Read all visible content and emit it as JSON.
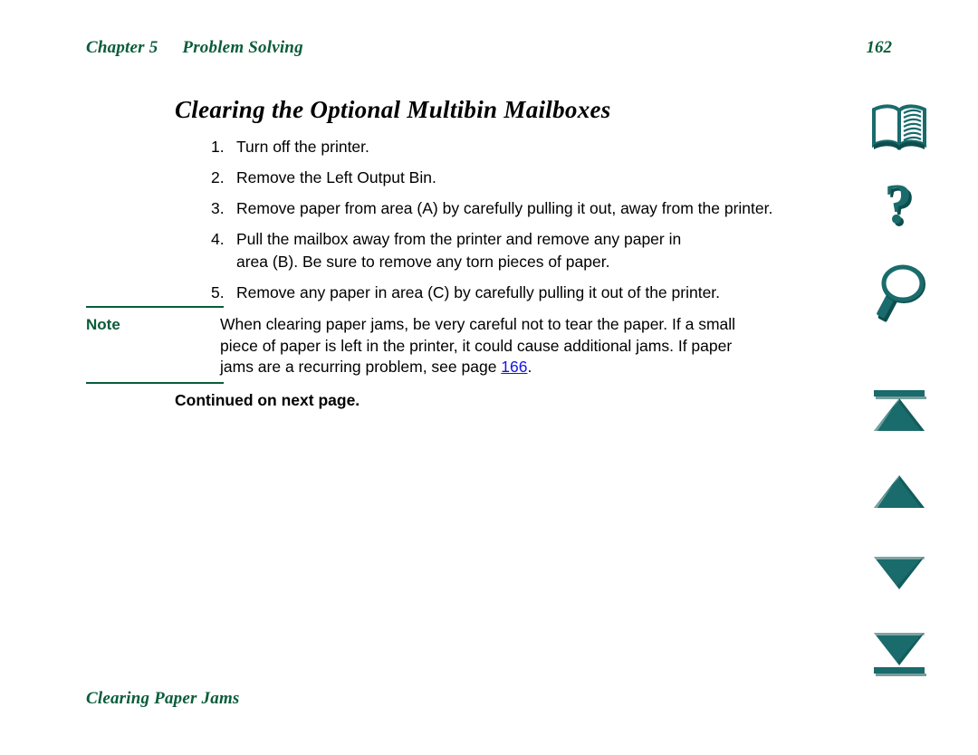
{
  "header": {
    "chapter": "Chapter 5",
    "section": "Problem Solving",
    "page_number": "162"
  },
  "title": "Clearing the Optional Multibin Mailboxes",
  "steps": [
    {
      "number": "1.",
      "line1": "Turn off the printer.",
      "line2": ""
    },
    {
      "number": "2.",
      "line1": "Remove the Left Output Bin.",
      "line2": ""
    },
    {
      "number": "3.",
      "line1": "Remove paper from area (A) by carefully pulling it out, away from the printer.",
      "line2": ""
    },
    {
      "number": "4.",
      "line1": "Pull the mailbox away from the printer and remove any paper in",
      "line2": "area (B). Be sure to remove any torn pieces of paper."
    },
    {
      "number": "5.",
      "line1": "Remove any paper in area (C) by carefully pulling it out of the printer.",
      "line2": ""
    }
  ],
  "note": {
    "label": "Note",
    "line1": "When clearing paper jams, be very careful not to tear the paper. If a small",
    "line2": "piece of paper is left in the printer, it could cause additional jams. If paper",
    "line3_prefix": "jams are a recurring problem, see page ",
    "link_text": "166",
    "line3_suffix": "."
  },
  "continued": "Continued on next page.",
  "footer": "Clearing Paper Jams",
  "icons": [
    {
      "name": "book-icon",
      "label": "Table of Contents"
    },
    {
      "name": "question-mark-icon",
      "label": "Help"
    },
    {
      "name": "magnifier-icon",
      "label": "Search"
    },
    {
      "name": "first-page-icon",
      "label": "First Page"
    },
    {
      "name": "previous-page-icon",
      "label": "Previous Page"
    },
    {
      "name": "next-page-icon",
      "label": "Next Page"
    },
    {
      "name": "last-page-icon",
      "label": "Last Page"
    }
  ],
  "colors": {
    "header_green": "#0a5c3a",
    "icon_teal": "#1a6b6b",
    "icon_teal_dark": "#0d4d4d",
    "link_blue": "#1414e6",
    "text_black": "#000000",
    "page_background": "#ffffff"
  }
}
